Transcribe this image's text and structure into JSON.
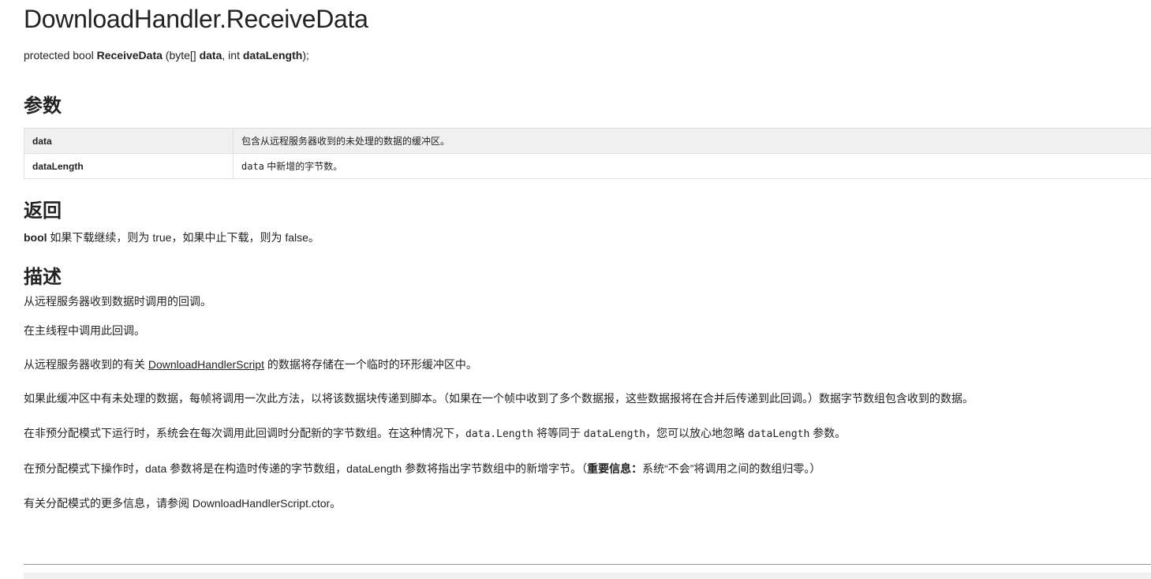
{
  "title": "DownloadHandler.ReceiveData",
  "signature": {
    "prefix": "protected bool ",
    "method": "ReceiveData",
    "open": " (byte[] ",
    "param1": "data",
    "mid": ", int ",
    "param2": "dataLength",
    "close": ");"
  },
  "parameters": {
    "heading": "参数",
    "rows": [
      {
        "name": "data",
        "desc": "包含从远程服务器收到的未处理的数据的缓冲区。"
      },
      {
        "name": "dataLength",
        "code": "data",
        "desc": " 中新增的字节数。"
      }
    ]
  },
  "returns": {
    "heading": "返回",
    "type": "bool",
    "text": " 如果下载继续，则为 true，如果中止下载，则为 false。"
  },
  "description": {
    "heading": "描述",
    "p1": "从远程服务器收到数据时调用的回调。",
    "p2": "在主线程中调用此回调。",
    "p3a": "从远程服务器收到的有关 ",
    "p3link": "DownloadHandlerScript",
    "p3b": " 的数据将存储在一个临时的环形缓冲区中。",
    "p4": "如果此缓冲区中有未处理的数据，每帧将调用一次此方法，以将该数据块传递到脚本。（如果在一个帧中收到了多个数据报，这些数据报将在合并后传递到此回调。）数据字节数组包含收到的数据。",
    "p5a": "在非预分配模式下运行时，系统会在每次调用此回调时分配新的字节数组。在这种情况下，",
    "p5c1": "data.Length",
    "p5b": " 将等同于 ",
    "p5c2": "dataLength",
    "p5c": "，您可以放心地忽略 ",
    "p5c3": "dataLength",
    "p5d": " 参数。",
    "p6a": "在预分配模式下操作时，data 参数将是在构造时传递的字节数组，dataLength 参数将指出字节数组中的新增字节。（",
    "p6bold": "重要信息：",
    "p6b": "系统“不会”将调用之间的数组归零。）",
    "p7": "有关分配模式的更多信息，请参阅 DownloadHandlerScript.ctor。"
  }
}
